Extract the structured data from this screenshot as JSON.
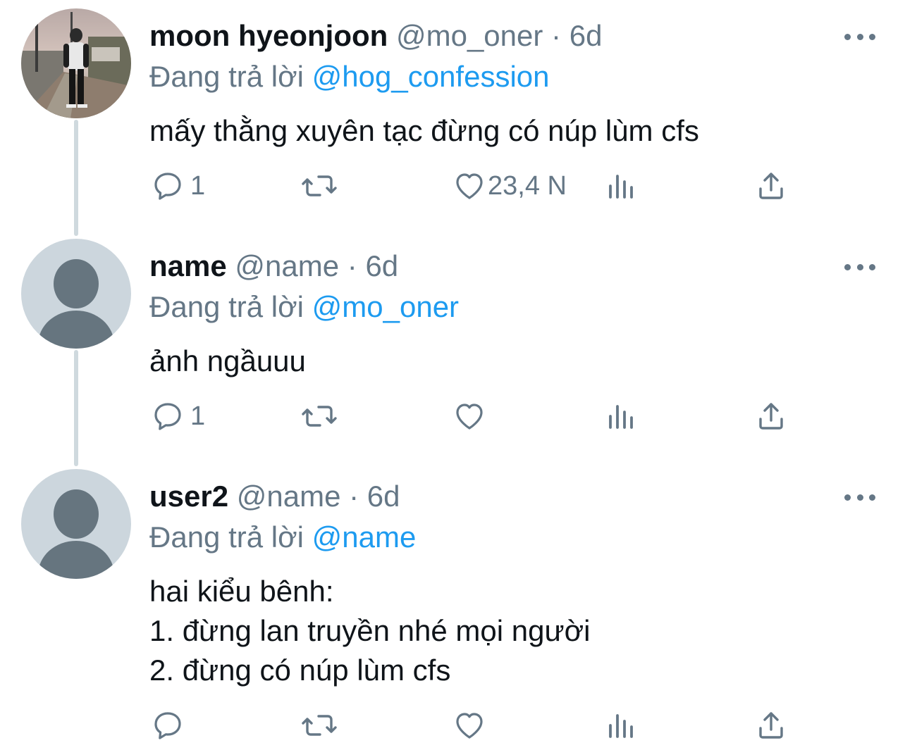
{
  "tweets": [
    {
      "display_name": "moon hyeonjoon",
      "handle": "@mo_oner",
      "separator": "·",
      "time": "6d",
      "reply_prefix": "Đang trả lời",
      "reply_to": "@hog_confession",
      "text": "mấy thằng xuyên tạc đừng có núp lùm cfs",
      "reply_count": "1",
      "retweet_count": "",
      "like_count": "23,4 N",
      "avatar": "photo-avatar"
    },
    {
      "display_name": "name",
      "handle": "@name",
      "separator": "·",
      "time": "6d",
      "reply_prefix": "Đang trả lời",
      "reply_to": "@mo_oner",
      "text": "ảnh ngầuuu",
      "reply_count": "1",
      "retweet_count": "",
      "like_count": "",
      "avatar": "default-avatar"
    },
    {
      "display_name": "user2",
      "handle": "@name",
      "separator": "·",
      "time": "6d",
      "reply_prefix": "Đang trả lời",
      "reply_to": "@name",
      "text": "hai kiểu bênh:\n1. đừng lan truyền nhé mọi người\n2. đừng có núp lùm cfs",
      "reply_count": "",
      "retweet_count": "",
      "like_count": "",
      "avatar": "default-avatar"
    }
  ],
  "icons": {
    "reply": "reply-icon",
    "retweet": "retweet-icon",
    "like": "heart-icon",
    "views": "analytics-icon",
    "share": "share-icon",
    "more": "more-icon"
  },
  "colors": {
    "mention": "#1d9bf0",
    "secondary_text": "#657786",
    "thread_line": "#cfd9de",
    "default_avatar_bg": "#ccd6dd",
    "default_avatar_fg": "#66757f"
  }
}
